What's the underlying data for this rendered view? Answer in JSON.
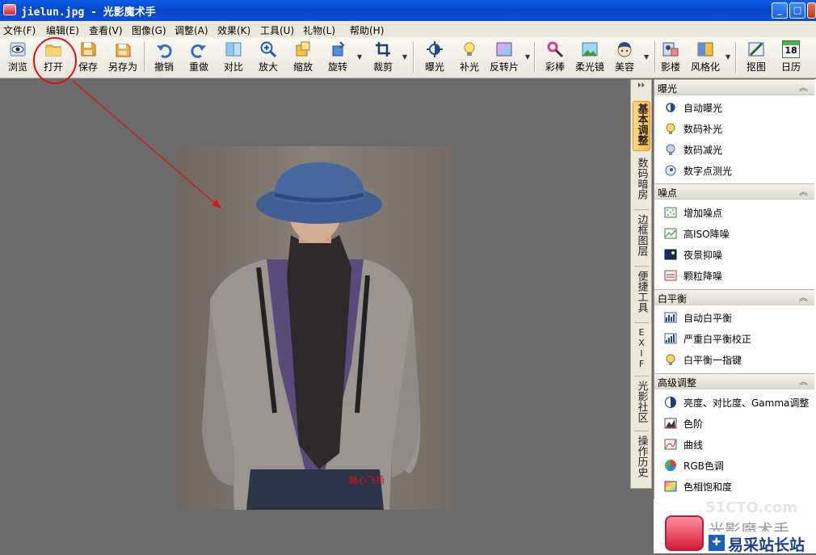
{
  "window": {
    "title": "jielun.jpg - 光影魔术手",
    "min": "_",
    "max": "□",
    "close": "×"
  },
  "menu": [
    "文件(F)",
    "编辑(E)",
    "查看(V)",
    "图像(G)",
    "调整(A)",
    "效果(K)",
    "工具(U)",
    "礼物(L)",
    "帮助(H)"
  ],
  "toolbar": {
    "browse": "浏览",
    "open": "打开",
    "save": "保存",
    "save_as": "另存为",
    "undo": "撤销",
    "redo": "重做",
    "compare": "对比",
    "zoom_in": "放大",
    "resize": "缩放",
    "rotate": "旋转",
    "crop": "裁剪",
    "exposure": "曝光",
    "fill_light": "补光",
    "reversal": "反转片",
    "color_pen": "彩棒",
    "soft_lens": "柔光镜",
    "beauty": "美容",
    "shadow": "影楼",
    "stylize": "风格化",
    "cutout": "抠图",
    "calendar": "日历",
    "calendar_day": "18"
  },
  "photo": {
    "watermark": "随心飞扬"
  },
  "side_tabs": [
    "基本调整",
    "数码暗房",
    "边框图层",
    "便捷工具",
    "EXIF",
    "光影社区",
    "操作历史"
  ],
  "panel": {
    "sections": [
      {
        "title": "曝光",
        "items": [
          "自动曝光",
          "数码补光",
          "数码减光",
          "数字点测光"
        ]
      },
      {
        "title": "噪点",
        "items": [
          "增加噪点",
          "高ISO降噪",
          "夜景抑噪",
          "颗粒降噪"
        ]
      },
      {
        "title": "白平衡",
        "items": [
          "自动白平衡",
          "严重白平衡校正",
          "白平衡一指键"
        ]
      },
      {
        "title": "高级调整",
        "items": [
          "亮度、对比度、Gamma调整",
          "色阶",
          "曲线",
          "RGB色调",
          "色相饱和度"
        ]
      }
    ]
  },
  "logo": {
    "product": "光影魔术手",
    "site": "易采站长站",
    "watermark": "51CTO.com"
  },
  "colors": {
    "titlebar": "#0747c9",
    "annotation": "#e01010",
    "active_tab": "#f7b84a"
  }
}
